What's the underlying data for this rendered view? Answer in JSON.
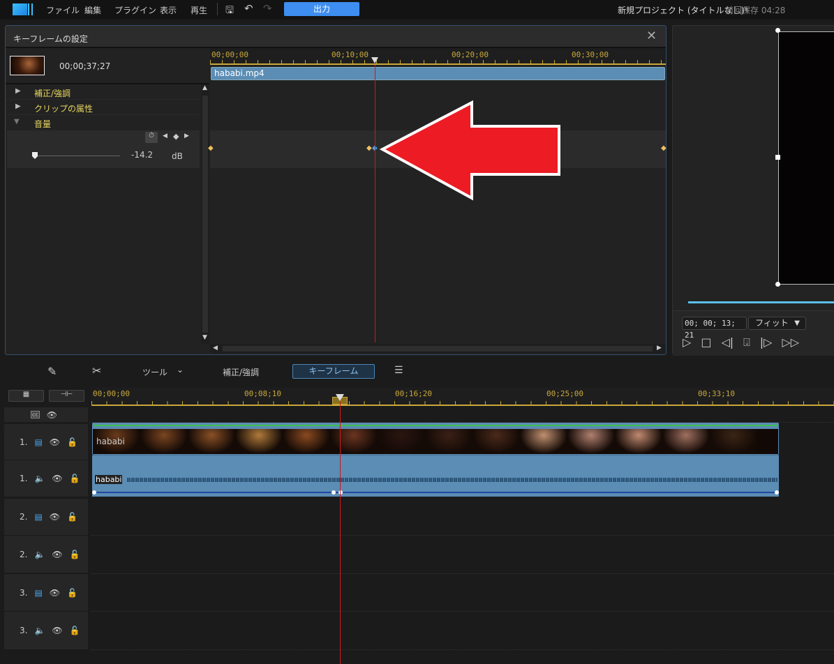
{
  "menu": {
    "file": "ファイル",
    "edit": "編集",
    "plugins": "プラグイン",
    "view": "表示",
    "playback": "再生",
    "export": "出力"
  },
  "project": {
    "title": "新規プロジェクト (タイトルなし)*",
    "saved": "前回保存 04:28"
  },
  "keyframe_panel": {
    "title": "キーフレームの設定",
    "clip_duration": "00;00;37;27",
    "ruler": [
      "00;00;00",
      "00;10;00",
      "00;20;00",
      "00;30;00"
    ],
    "clip_name": "hababi.mp4",
    "sections": [
      {
        "label": "補正/強調",
        "expanded": false
      },
      {
        "label": "クリップの属性",
        "expanded": false
      },
      {
        "label": "音量",
        "expanded": true
      }
    ],
    "volume_value": "-14.2",
    "volume_unit": "dB",
    "volume_slider_fraction": 0.05
  },
  "preview": {
    "timecode": "00; 00; 13; 21",
    "zoom": "フィット"
  },
  "toolbar": {
    "tools": "ツール",
    "fix": "補正/強調",
    "keyframe": "キーフレーム"
  },
  "timeline": {
    "ruler": [
      "00;00;00",
      "00;08;10",
      "00;16;20",
      "00;25;00",
      "00;33;10"
    ],
    "tracks": [
      {
        "num": "1.",
        "type": "video"
      },
      {
        "num": "1.",
        "type": "audio"
      },
      {
        "num": "2.",
        "type": "video"
      },
      {
        "num": "2.",
        "type": "audio"
      },
      {
        "num": "3.",
        "type": "video"
      },
      {
        "num": "3.",
        "type": "audio"
      }
    ],
    "video_clip_label": "hababi",
    "audio_clip_label": "hababi"
  },
  "colors": {
    "accent": "#3d8ef0",
    "playhead": "#d01818",
    "ruler": "#c9a83a",
    "clip": "#5b8db5",
    "arrow": "#ed1c24"
  }
}
